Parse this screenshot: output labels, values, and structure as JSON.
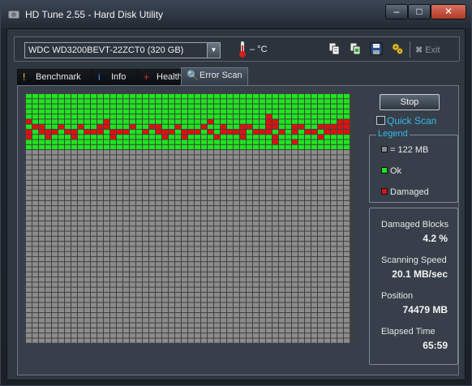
{
  "window": {
    "title": "HD Tune 2.55 - Hard Disk Utility",
    "min_glyph": "–",
    "max_glyph": "□",
    "close_glyph": "✕"
  },
  "toolbar": {
    "drive": "WDC WD3200BEVT-22ZCT0 (320 GB)",
    "temperature": "– °C",
    "exit_label": "Exit",
    "icons": [
      "copy-info-icon",
      "copy-screenshot-icon",
      "save-icon",
      "options-icon",
      "exit-icon"
    ]
  },
  "tabs": [
    {
      "label": "Benchmark",
      "icon": "benchmark-icon"
    },
    {
      "label": "Info",
      "icon": "info-icon"
    },
    {
      "label": "Health",
      "icon": "health-icon"
    },
    {
      "label": "Error Scan",
      "icon": "error-scan-icon",
      "active": true
    }
  ],
  "scan": {
    "stop_label": "Stop",
    "quick_scan_label": "Quick Scan",
    "quick_scan_checked": false,
    "legend_title": "Legend",
    "legend": [
      {
        "label": "= 122 MB",
        "color": "#8c8c8c"
      },
      {
        "label": "Ok",
        "color": "#1ee51e"
      },
      {
        "label": "Damaged",
        "color": "#e01010"
      }
    ],
    "colors": {
      "untested": "#8c8c8c",
      "ok": "#1ee51e",
      "damaged": "#e01010",
      "grid_line": "#404040"
    },
    "columns": 50,
    "rows": 49,
    "damaged_rows": [
      [
        0,
        0,
        0,
        0,
        0,
        0,
        0,
        0,
        0,
        0,
        0,
        0,
        0,
        0,
        0,
        0,
        0,
        0,
        0,
        0,
        0,
        0,
        0,
        0,
        0,
        0,
        0,
        0,
        0,
        0,
        0,
        0,
        0,
        0,
        0,
        0,
        0,
        1,
        0,
        0,
        0,
        0,
        0,
        0,
        0,
        0,
        0,
        0,
        0,
        0
      ],
      [
        1,
        0,
        0,
        0,
        0,
        0,
        0,
        0,
        0,
        0,
        0,
        0,
        1,
        0,
        0,
        0,
        0,
        0,
        0,
        0,
        0,
        0,
        0,
        0,
        0,
        0,
        0,
        0,
        1,
        0,
        0,
        0,
        0,
        0,
        0,
        0,
        0,
        1,
        1,
        0,
        0,
        0,
        0,
        0,
        0,
        0,
        0,
        0,
        1,
        1
      ],
      [
        0,
        1,
        1,
        0,
        0,
        1,
        0,
        0,
        1,
        0,
        0,
        1,
        1,
        0,
        0,
        0,
        1,
        0,
        0,
        1,
        1,
        0,
        0,
        1,
        0,
        0,
        0,
        1,
        0,
        0,
        1,
        0,
        0,
        1,
        1,
        0,
        0,
        1,
        1,
        0,
        0,
        1,
        1,
        0,
        0,
        1,
        1,
        1,
        1,
        1
      ],
      [
        1,
        0,
        1,
        1,
        1,
        0,
        1,
        1,
        0,
        1,
        1,
        1,
        0,
        1,
        1,
        1,
        0,
        0,
        1,
        0,
        1,
        1,
        1,
        0,
        1,
        1,
        1,
        0,
        1,
        0,
        1,
        1,
        1,
        1,
        0,
        1,
        1,
        1,
        0,
        1,
        0,
        1,
        0,
        1,
        1,
        0,
        1,
        1,
        1,
        1
      ],
      [
        1,
        0,
        0,
        1,
        0,
        0,
        0,
        1,
        0,
        0,
        0,
        0,
        0,
        1,
        0,
        0,
        0,
        0,
        0,
        0,
        0,
        1,
        0,
        0,
        1,
        0,
        0,
        0,
        0,
        1,
        0,
        0,
        0,
        1,
        0,
        0,
        0,
        0,
        1,
        0,
        0,
        0,
        0,
        0,
        0,
        1,
        0,
        0,
        0,
        0
      ],
      [
        0,
        0,
        0,
        0,
        0,
        0,
        0,
        0,
        0,
        0,
        0,
        0,
        0,
        0,
        0,
        0,
        0,
        0,
        0,
        0,
        0,
        0,
        0,
        0,
        0,
        0,
        0,
        0,
        0,
        0,
        0,
        0,
        0,
        0,
        0,
        0,
        0,
        0,
        1,
        0,
        0,
        1,
        0,
        0,
        0,
        0,
        0,
        0,
        0,
        0
      ]
    ],
    "stats": [
      {
        "label": "Damaged Blocks",
        "value": "4.2 %"
      },
      {
        "label": "Scanning Speed",
        "value": "20.1 MB/sec"
      },
      {
        "label": "Position",
        "value": "74479 MB"
      },
      {
        "label": "Elapsed Time",
        "value": "65:59"
      }
    ]
  }
}
